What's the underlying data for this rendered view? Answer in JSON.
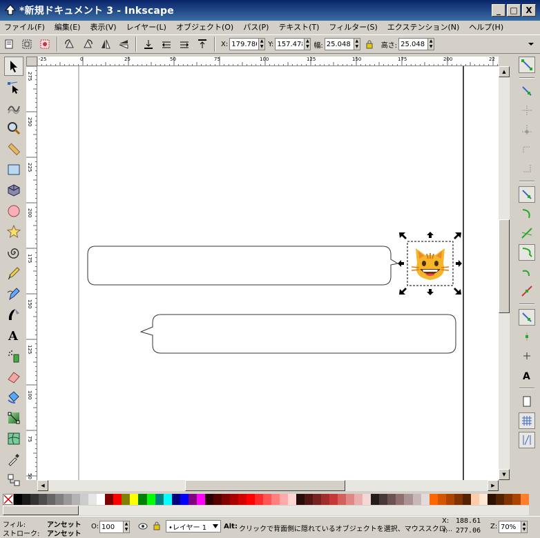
{
  "window": {
    "title": "*新規ドキュメント 3 - Inkscape",
    "buttons": {
      "minimize": "_",
      "maximize": "□",
      "close": "X"
    }
  },
  "menu": [
    "ファイル(F)",
    "編集(E)",
    "表示(V)",
    "レイヤー(L)",
    "オブジェクト(O)",
    "パス(P)",
    "テキスト(T)",
    "フィルター(S)",
    "エクステンション(N)",
    "ヘルプ(H)"
  ],
  "toolbar": {
    "x_label": "X:",
    "x_value": "179.780",
    "y_label": "Y:",
    "y_value": "157.478",
    "w_label": "幅:",
    "w_value": "25.048",
    "h_label": "高さ:",
    "h_value": "25.048"
  },
  "ruler_top_labels": [
    "-25",
    "0",
    "25",
    "50",
    "75",
    "100",
    "125",
    "150",
    "175",
    "200",
    "22"
  ],
  "ruler_left_labels": [
    "275",
    "250",
    "225",
    "200",
    "175",
    "150",
    "125",
    "100",
    "75",
    "50"
  ],
  "canvas": {
    "emoji": "😺"
  },
  "palette": [
    "#000000",
    "#1a1a1a",
    "#333333",
    "#4d4d4d",
    "#666666",
    "#808080",
    "#999999",
    "#b3b3b3",
    "#cccccc",
    "#e6e6e6",
    "#ffffff",
    "#800000",
    "#ff0000",
    "#808000",
    "#ffff00",
    "#008000",
    "#00ff00",
    "#008080",
    "#00ffff",
    "#000080",
    "#0000ff",
    "#800080",
    "#ff00ff",
    "#2b0000",
    "#550000",
    "#800000",
    "#aa0000",
    "#d40000",
    "#ff0000",
    "#ff2a2a",
    "#ff5555",
    "#ff8080",
    "#ffaaaa",
    "#ffd5d5",
    "#280b0b",
    "#501616",
    "#782121",
    "#a02c2c",
    "#c83737",
    "#d35f5f",
    "#de8787",
    "#e9afaf",
    "#f4d7d7",
    "#241c1c",
    "#483737",
    "#6c5353",
    "#916f6f",
    "#ac9393",
    "#c8b7b7",
    "#e3dbdb",
    "#ff6600",
    "#d45500",
    "#aa4400",
    "#803300",
    "#552200",
    "#ffccaa",
    "#ffe6d5",
    "#2b1100",
    "#552200",
    "#803300",
    "#aa4400",
    "#ff7f2a"
  ],
  "status": {
    "fill_label": "フィル:",
    "fill_value": "アンセット",
    "stroke_label": "ストローク:",
    "stroke_value": "アンセット",
    "opacity_label": "O:",
    "opacity_value": "100",
    "layer_value": "•レイヤー 1",
    "message_bold": "Alt:",
    "message": "クリックで背面側に隠れているオブジェクトを選択、マウススクロ...",
    "coord_x_label": "X:",
    "coord_x": "188.61",
    "coord_y_label": "Y:",
    "coord_y": "277.06",
    "zoom_label": "Z:",
    "zoom_value": "70%"
  }
}
